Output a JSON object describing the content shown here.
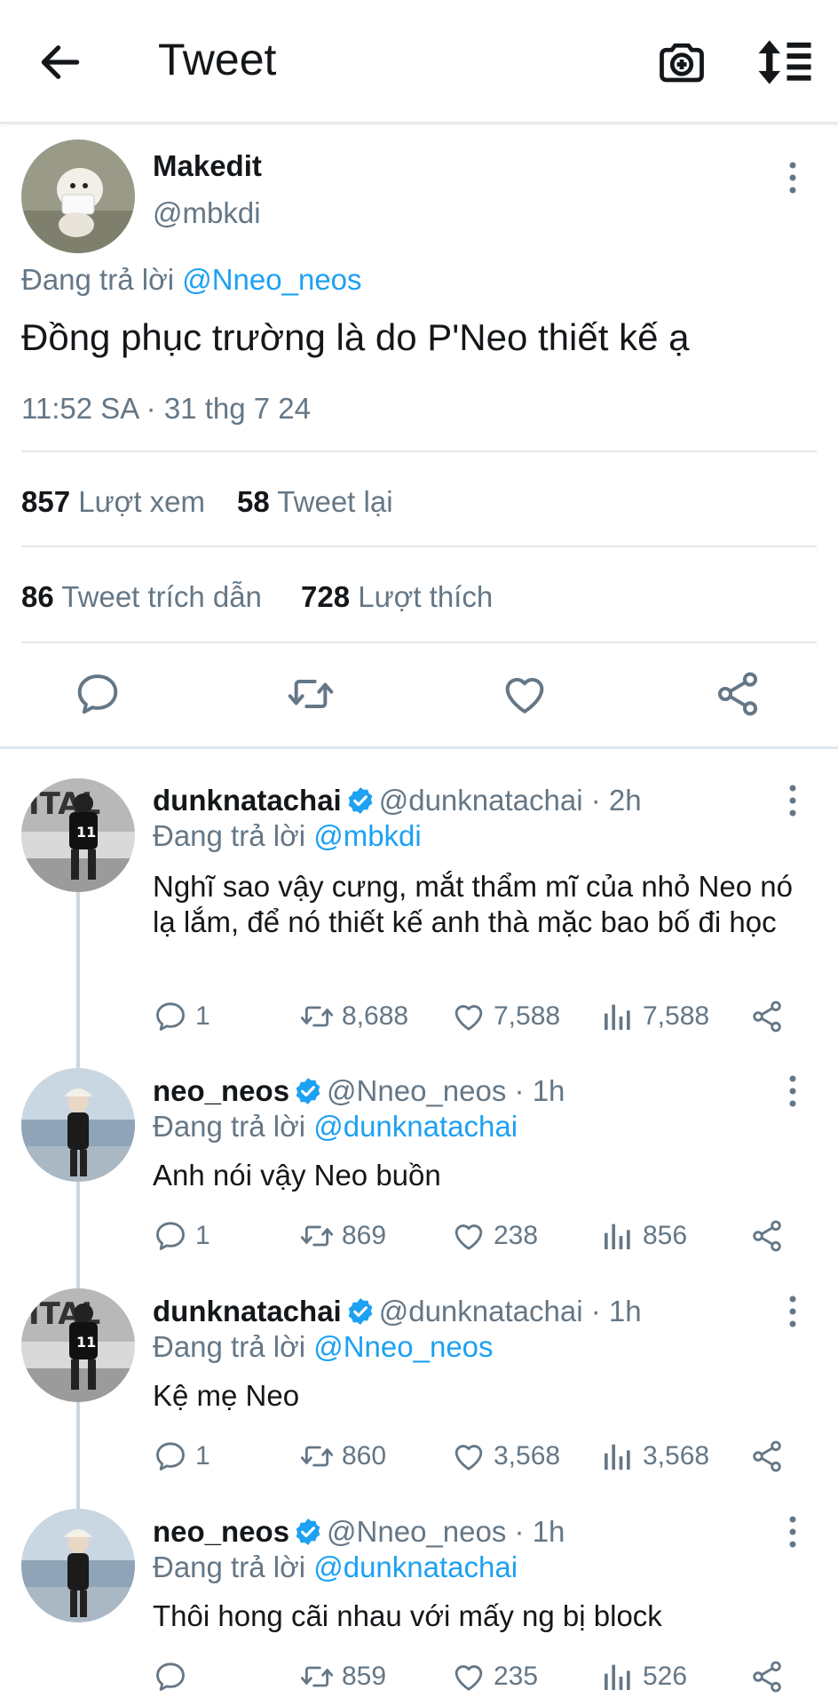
{
  "header": {
    "title": "Tweet"
  },
  "main_tweet": {
    "name": "Makedit",
    "handle": "@mbkdi",
    "reply_prefix": "Đang trả lời",
    "reply_to": "@Nneo_neos",
    "text": "Đồng phục trường là do P'Neo thiết kế ạ",
    "timestamp": "11:52 SA · 31 thg 7 24",
    "stats": {
      "views_count": "857",
      "views_label": "Lượt xem",
      "retweets_count": "58",
      "retweets_label": "Tweet lại",
      "quotes_count": "86",
      "quotes_label": "Tweet trích dẫn",
      "likes_count": "728",
      "likes_label": "Lượt thích"
    }
  },
  "replies": [
    {
      "name": "dunknatachai",
      "handle": "@dunknatachai",
      "time": "· 2h",
      "reply_prefix": "Đang trả lời",
      "reply_to": "@mbkdi",
      "text": "Nghĩ sao vậy cưng, mắt thẩm mĩ của nhỏ Neo nó lạ lắm, để nó thiết kế anh thà mặc bao bố đi học",
      "replies": "1",
      "retweets": "8,688",
      "likes": "7,588",
      "views": "7,588"
    },
    {
      "name": "neo_neos",
      "handle": "@Nneo_neos",
      "time": "· 1h",
      "reply_prefix": "Đang trả lời",
      "reply_to": "@dunknatachai",
      "text": "Anh nói vậy Neo buồn",
      "replies": "1",
      "retweets": "869",
      "likes": "238",
      "views": "856"
    },
    {
      "name": "dunknatachai",
      "handle": "@dunknatachai",
      "time": "· 1h",
      "reply_prefix": "Đang trả lời",
      "reply_to": "@Nneo_neos",
      "text": "Kệ mẹ Neo",
      "replies": "1",
      "retweets": "860",
      "likes": "3,568",
      "views": "3,568"
    },
    {
      "name": "neo_neos",
      "handle": "@Nneo_neos",
      "time": "· 1h",
      "reply_prefix": "Đang trả lời",
      "reply_to": "@dunknatachai",
      "text": "Thôi hong cãi nhau với mấy ng bị block",
      "replies": "",
      "retweets": "859",
      "likes": "235",
      "views": "526"
    }
  ],
  "colors": {
    "accent": "#1da1f2",
    "muted": "#657786",
    "text": "#14171a",
    "divider": "#e1e8ed"
  },
  "icons": [
    "back-arrow-icon",
    "camera-plus-icon",
    "sort-icon",
    "more-vertical-icon",
    "reply-icon",
    "retweet-icon",
    "like-icon",
    "share-icon",
    "views-icon",
    "verified-badge-icon"
  ]
}
